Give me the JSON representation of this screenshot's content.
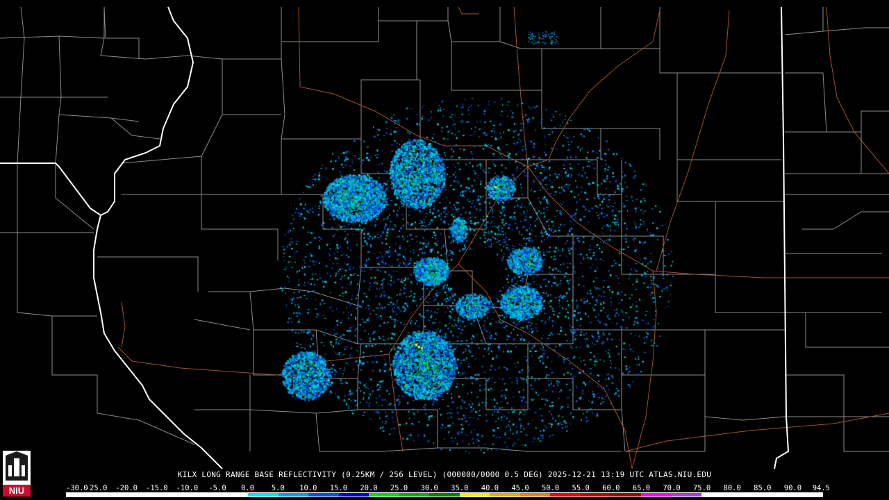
{
  "caption": {
    "text": "KILX LONG RANGE BASE REFLECTIVITY (0.25KM / 256 LEVEL) (000000/0000 0.5 DEG) 2025-12-21 13:19 UTC  ATLAS.NIU.EDU"
  },
  "logo": {
    "text": "NIU",
    "icon": "niu-tower-logo-icon",
    "color": "#c8102e"
  },
  "color_scale": {
    "labels": [
      "-30.0",
      "-25.0",
      "-20.0",
      "-15.0",
      "-10.0",
      "-5.0",
      "0.0",
      "5.0",
      "10.0",
      "15.0",
      "20.0",
      "25.0",
      "30.0",
      "35.0",
      "40.0",
      "45.0",
      "50.0",
      "55.0",
      "60.0",
      "65.0",
      "70.0",
      "75.0",
      "80.0",
      "85.0",
      "90.0",
      "94.5"
    ],
    "colors": [
      "#ffffff",
      "#ffffff",
      "#ffffff",
      "#ffffff",
      "#ffffff",
      "#ffffff",
      "#00e8e8",
      "#00a0f0",
      "#0050f0",
      "#0000d0",
      "#00e000",
      "#00b000",
      "#008000",
      "#f0f000",
      "#e0b000",
      "#f08000",
      "#f00000",
      "#c00000",
      "#a00000",
      "#ff00ff",
      "#a040e0",
      "#ffffff",
      "#ffffff",
      "#ffffff",
      "#ffffff"
    ]
  },
  "map": {
    "background": "#000000",
    "county_line_color": "#8c8c8c",
    "state_line_color": "#ffffff",
    "river_color": "#ffffff",
    "highway_color": "#a0522d",
    "radar_site": "KILX"
  }
}
